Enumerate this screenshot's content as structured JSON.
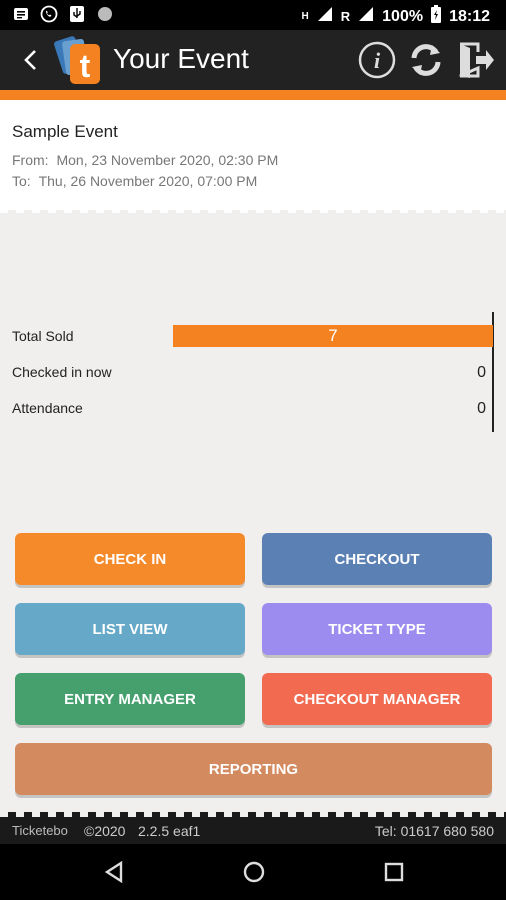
{
  "status_bar": {
    "signal_label": "R",
    "battery": "100%",
    "time": "18:12",
    "network_label": "H"
  },
  "app_bar": {
    "title": "Your Event"
  },
  "event": {
    "name": "Sample Event",
    "from_label": "From:",
    "from_value": "Mon, 23 November 2020, 02:30 PM",
    "to_label": "To:",
    "to_value": "Thu, 26 November 2020, 07:00 PM"
  },
  "stats": [
    {
      "label": "Total Sold",
      "value": "7"
    },
    {
      "label": "Checked in now",
      "value": "0"
    },
    {
      "label": "Attendance",
      "value": "0"
    }
  ],
  "buttons": {
    "check_in": "CHECK IN",
    "checkout": "CHECKOUT",
    "list_view": "LIST VIEW",
    "ticket_type": "TICKET TYPE",
    "entry_manager": "ENTRY MANAGER",
    "checkout_manager": "CHECKOUT MANAGER",
    "reporting": "REPORTING"
  },
  "colors": {
    "brand_orange": "#f58220",
    "check_in": "#f58a2a",
    "checkout": "#5b80b4",
    "list_view": "#66a8c8",
    "ticket_type": "#9c8cf0",
    "entry_manager": "#45a06e",
    "checkout_manager": "#f26a50",
    "reporting": "#d28a5e"
  },
  "footer": {
    "brand": "Ticketebo",
    "copyright": "©2020",
    "version": "2.2.5 eaf1",
    "phone": "Tel: 01617 680 580"
  }
}
